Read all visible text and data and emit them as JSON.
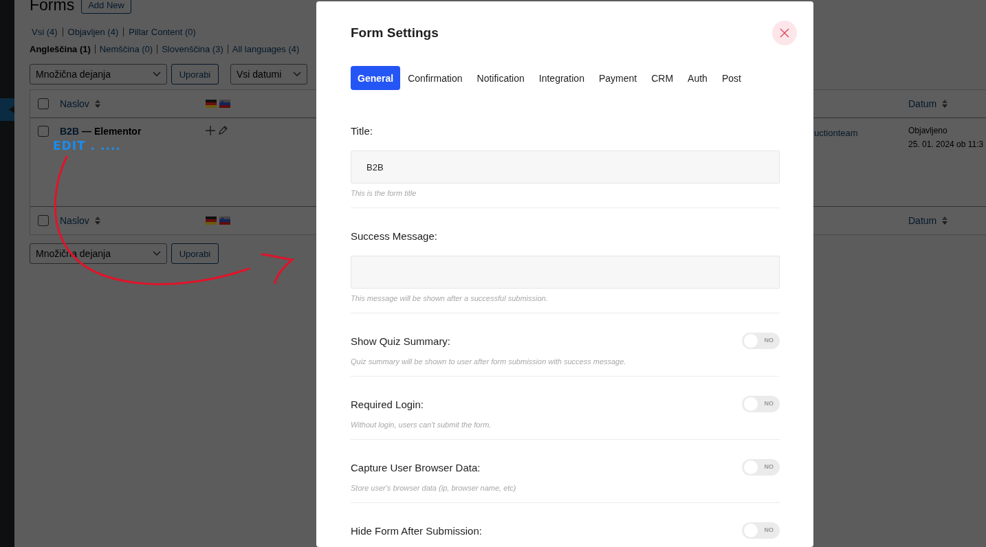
{
  "admin_page": {
    "title": "Forms",
    "add_new": "Add New",
    "status_filters": [
      {
        "label": "Vsi (4)"
      },
      {
        "label": "Objavljen (4)"
      },
      {
        "label": "Pillar Content (0)"
      }
    ],
    "language_filters": [
      {
        "label": "Angleščina (1)",
        "selected": true
      },
      {
        "label": "Nemščina (0)",
        "selected": false
      },
      {
        "label": "Slovenščina (3)",
        "selected": false
      },
      {
        "label": "All languages (4)",
        "selected": false
      }
    ],
    "bulk_actions": {
      "select": "Množična dejanja",
      "apply": "Uporabi"
    },
    "date_filter": "Vsi datumi",
    "table": {
      "header": {
        "checked": false,
        "title_column": "Naslov",
        "date_column": "Datum"
      },
      "rows": [
        {
          "checked": false,
          "title": "B2B",
          "suffix": "— Elementor",
          "author": "uctionteam",
          "status": "Objavljeno",
          "date": "25. 01. 2024 ob 11:3"
        }
      ],
      "footer": {
        "checked": false,
        "title_column": "Naslov",
        "date_column": "Datum"
      }
    },
    "bottom_bulk_actions": {
      "select": "Množična dejanja",
      "apply": "Uporabi"
    }
  },
  "annotation": {
    "text": "EDIT . ...."
  },
  "modal": {
    "title": "Form Settings",
    "tabs": [
      {
        "label": "General",
        "selected": true
      },
      {
        "label": "Confirmation",
        "selected": false
      },
      {
        "label": "Notification",
        "selected": false
      },
      {
        "label": "Integration",
        "selected": false
      },
      {
        "label": "Payment",
        "selected": false
      },
      {
        "label": "CRM",
        "selected": false
      },
      {
        "label": "Auth",
        "selected": false
      },
      {
        "label": "Post",
        "selected": false
      }
    ],
    "sections": [
      {
        "kind": "input",
        "label": "Title:",
        "value": "B2B",
        "help": "This is the form title"
      },
      {
        "kind": "input",
        "label": "Success Message:",
        "help": "This message will be shown after a successful submission."
      },
      {
        "kind": "toggle",
        "label": "Show Quiz Summary:",
        "on": false,
        "toggle_text": "NO",
        "help": "Quiz summary will be shown to user after form submission with success message."
      },
      {
        "kind": "toggle",
        "label": "Required Login:",
        "on": false,
        "toggle_text": "NO",
        "help": "Without login, users can't submit the form."
      },
      {
        "kind": "toggle",
        "label": "Capture User Browser Data:",
        "on": false,
        "toggle_text": "NO",
        "help": "Store user's browser data (ip, browser name, etc)"
      },
      {
        "kind": "toggle",
        "label": "Hide Form After Submission:",
        "on": false,
        "toggle_text": "NO"
      }
    ]
  }
}
